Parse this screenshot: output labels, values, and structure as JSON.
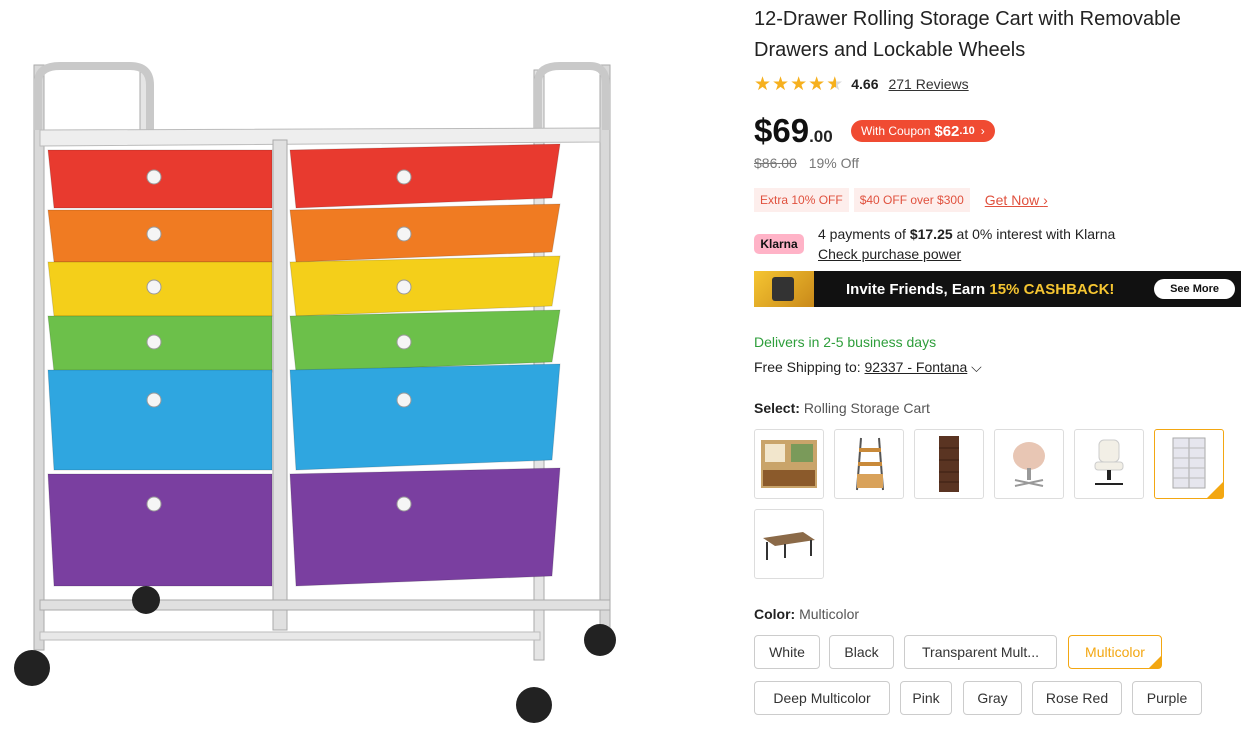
{
  "product": {
    "title": "12-Drawer Rolling Storage Cart with Removable Drawers and Lockable Wheels",
    "rating": "4.66",
    "reviews": "271 Reviews",
    "rating_value": 4.66
  },
  "price": {
    "main": "$69",
    "cents": ".00",
    "coupon_label": "With Coupon",
    "coupon_price": "$62",
    "coupon_cents": ".10",
    "original": "$86.00",
    "discount": "19% Off"
  },
  "promos": {
    "items": [
      "Extra 10% OFF",
      "$40 OFF over $300"
    ],
    "get_now": "Get Now"
  },
  "klarna": {
    "logo": "Klarna",
    "line_pre": "4 payments of ",
    "amount": "$17.25",
    "line_post": " at 0% interest with Klarna",
    "link": "Check purchase power"
  },
  "banner": {
    "text_pre": "Invite Friends, Earn ",
    "highlight": "15% CASHBACK!",
    "button": "See More"
  },
  "delivery": {
    "delivers": "Delivers in 2-5 business days",
    "ship_label": "Free Shipping to: ",
    "zip": "92337 - Fontana"
  },
  "select": {
    "label": "Select:",
    "value": "Rolling Storage Cart",
    "options": [
      "living-room-desk",
      "ladder-shelf",
      "bookcase",
      "pink-office-chair",
      "white-desk-chair",
      "rolling-storage-cart",
      "l-shaped-desk"
    ],
    "selected_index": 5
  },
  "color": {
    "label": "Color:",
    "value": "Multicolor",
    "options": [
      "White",
      "Black",
      "Transparent Mult...",
      "Multicolor",
      "Deep Multicolor",
      "Pink",
      "Gray",
      "Rose Red",
      "Purple"
    ],
    "selected_index": 3
  },
  "colors": {
    "accent": "#f3a712",
    "coupon": "#f04b32",
    "promo_text": "#e0513e",
    "delivers": "#2e9e3b",
    "klarna": "#ffb3c7",
    "drawers": [
      "#e83a2f",
      "#f07b22",
      "#f4cf1a",
      "#6cc04a",
      "#2fa6e0",
      "#7a3fa0"
    ]
  }
}
